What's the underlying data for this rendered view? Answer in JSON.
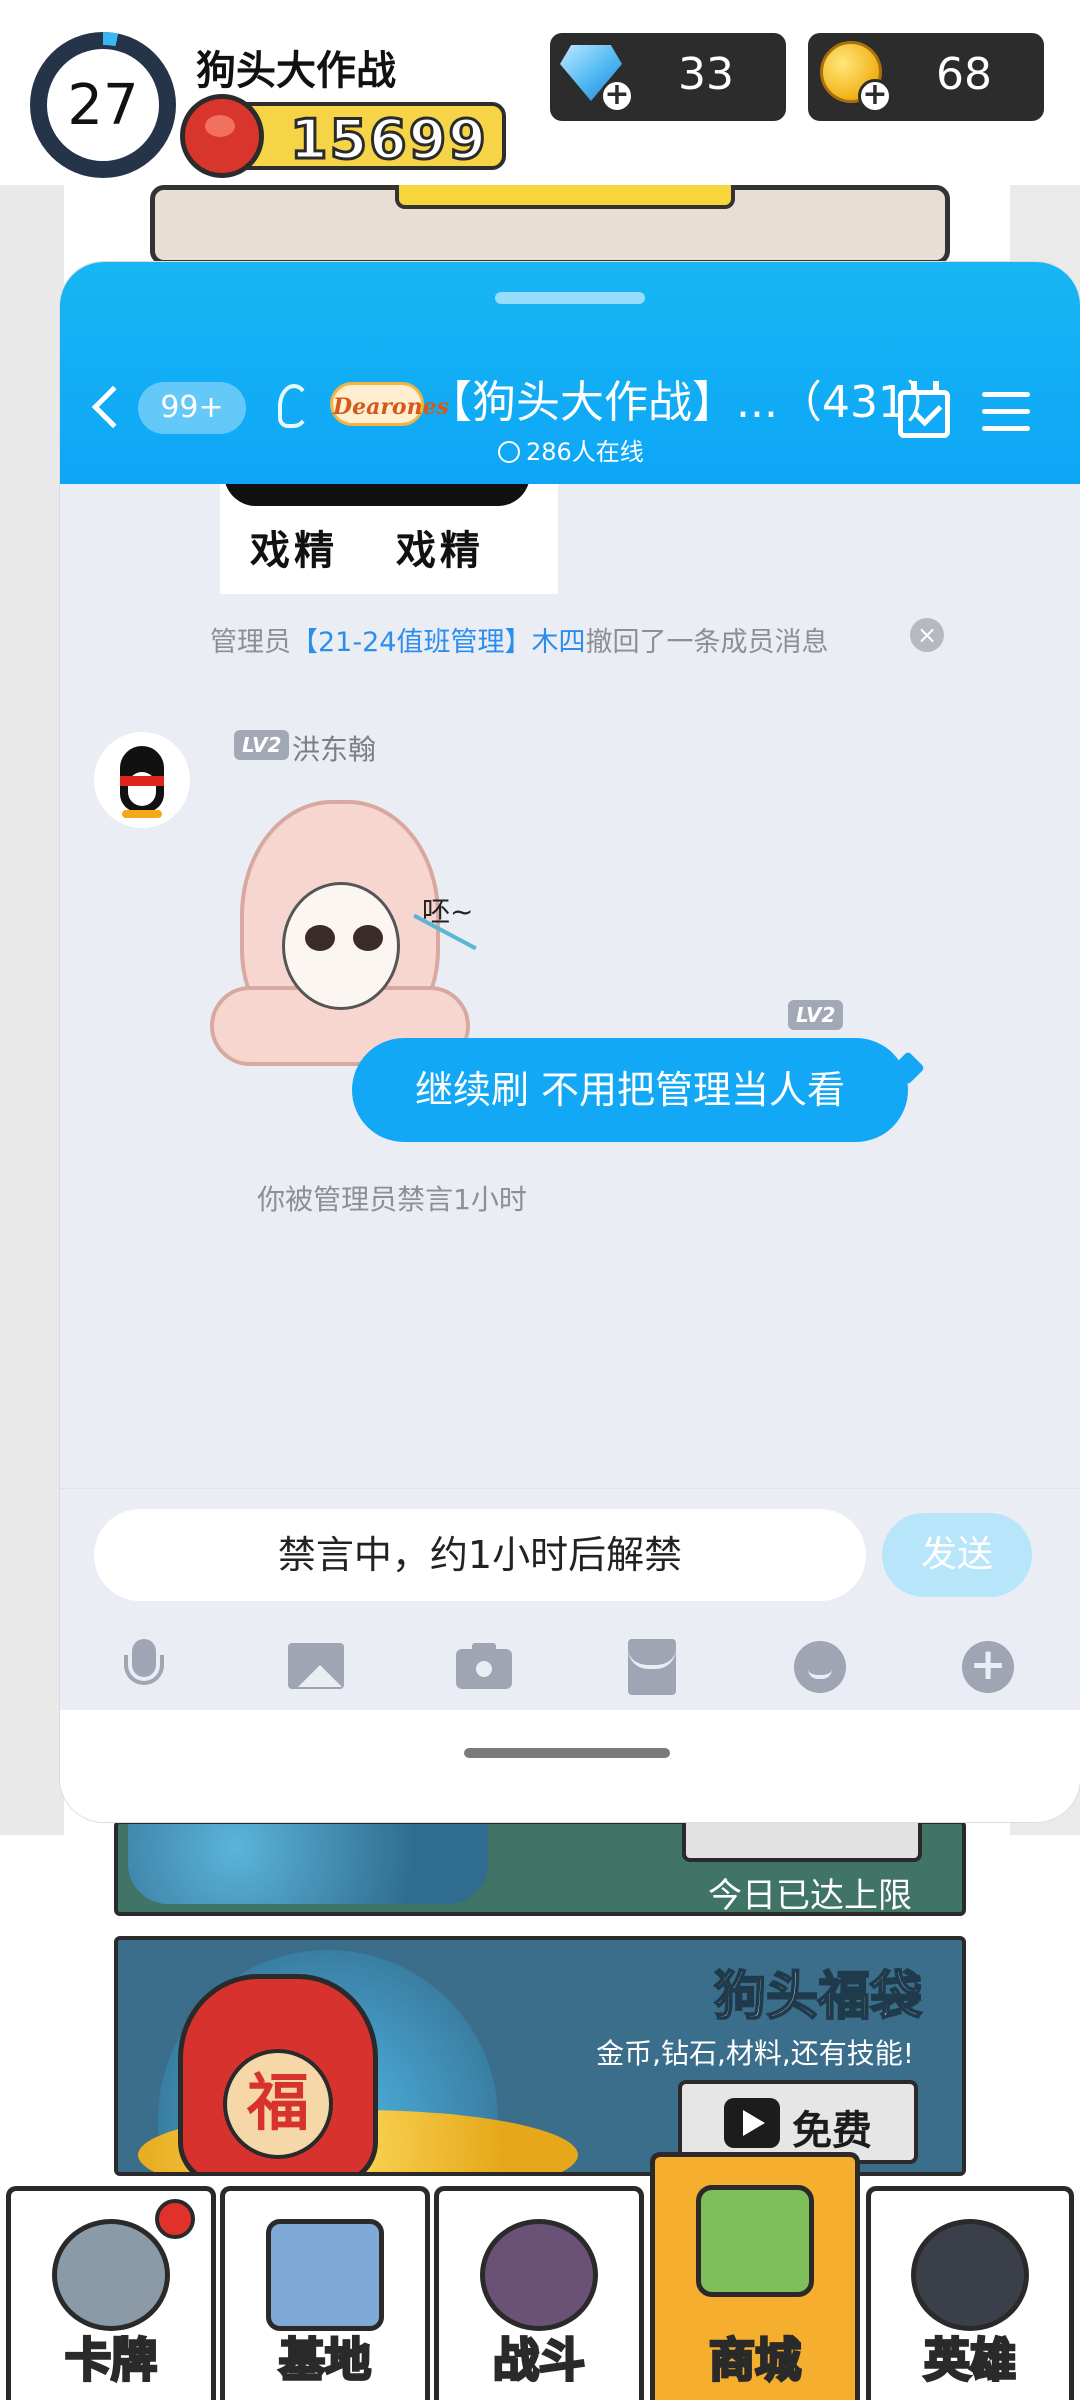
{
  "hud": {
    "level": "27",
    "game_name": "狗头大作战",
    "score": "15699",
    "diamonds": "33",
    "coins": "68",
    "icons": [
      "level-ring-icon",
      "boxing-glove-icon",
      "diamond-plus-icon",
      "coin-plus-icon"
    ]
  },
  "chat": {
    "unread_count": "99+",
    "group_logo_text": "Dearones",
    "group_title": "【狗头大作战】...（431）",
    "online_text": "286人在线",
    "sticker_caption_left": "戏精",
    "sticker_caption_right": "戏精",
    "notice_prefix": "管理员",
    "notice_admin": "【21-24值班管理】木四",
    "notice_suffix": "撤回了一条成员消息",
    "notice_close": "×",
    "sender_level": "LV2",
    "sender_name": "洪东翰",
    "sticker_text": "呸~",
    "my_level": "LV2",
    "my_message": "继续刷 不用把管理当人看",
    "mute_notice": "你被管理员禁言1小时",
    "input_placeholder": "禁言中，约1小时后解禁",
    "send_label": "发送",
    "plus_glyph": "+",
    "toolbar_icons": [
      "mic-icon",
      "image-icon",
      "camera-icon",
      "red-packet-icon",
      "emoji-icon",
      "plus-icon"
    ],
    "colors": {
      "header": "#0da6f6",
      "bubble": "#13a8f5",
      "send_disabled": "#b7e6fb"
    }
  },
  "panels": {
    "welfare_status": "今日已达上限",
    "bag_title": "狗头福袋",
    "bag_subtitle": "金币,钻石,材料,还有技能!",
    "bag_char": "福",
    "free_label": "免费"
  },
  "tabs": [
    {
      "label": "卡牌",
      "has_badge": true
    },
    {
      "label": "基地",
      "has_badge": false
    },
    {
      "label": "战斗",
      "has_badge": false
    },
    {
      "label": "商城",
      "active": true
    },
    {
      "label": "英雄",
      "has_badge": false
    }
  ]
}
